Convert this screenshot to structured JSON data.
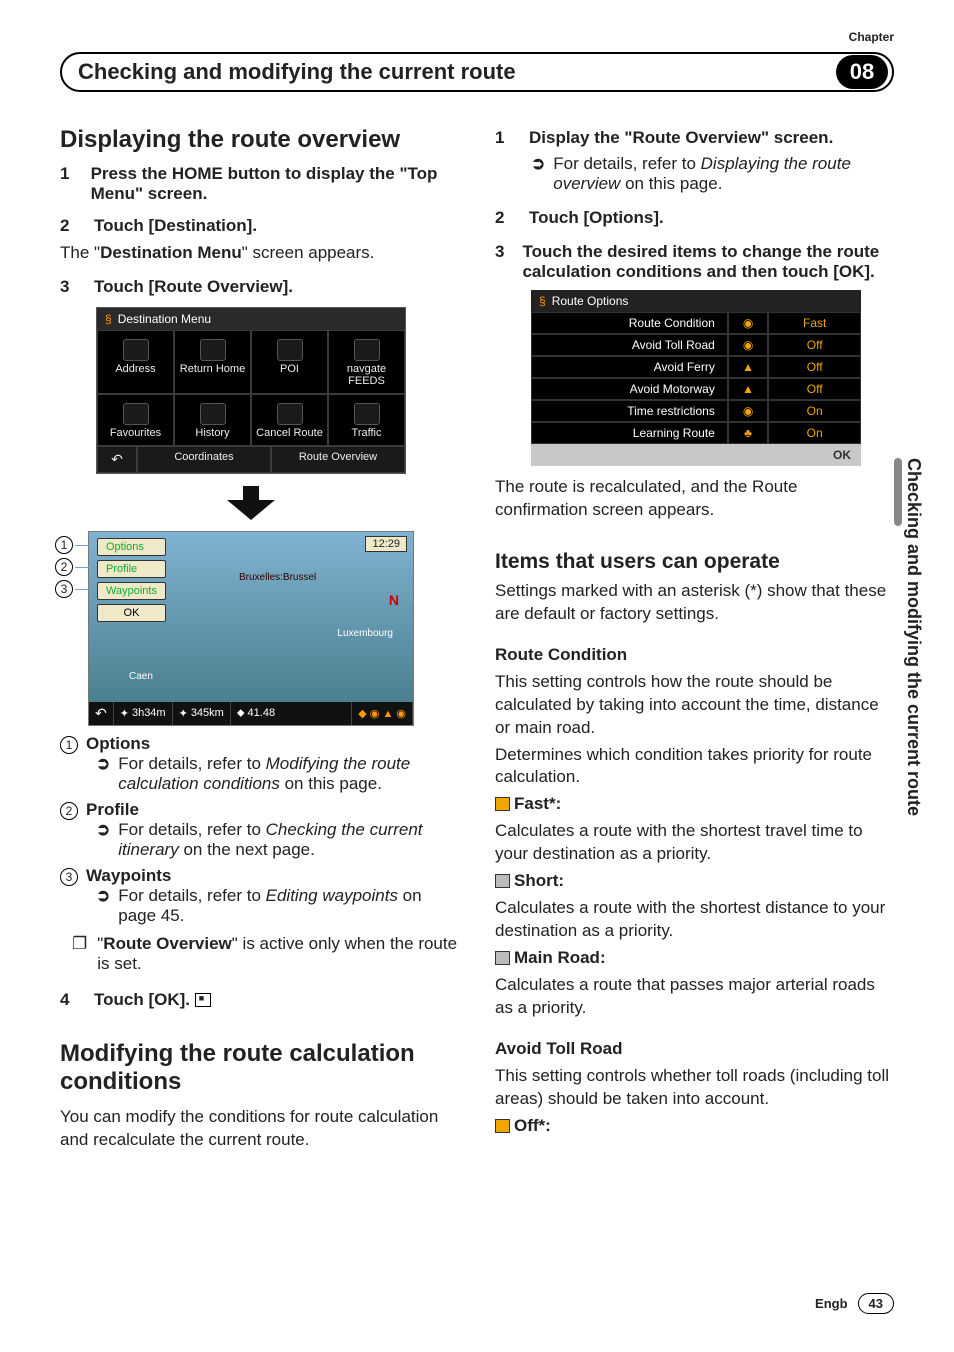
{
  "chapterLabel": "Chapter",
  "chapterNum": "08",
  "topTitle": "Checking and modifying the current route",
  "sideTitle": "Checking and modifying the current route",
  "left": {
    "h1": "Displaying the route overview",
    "s1": "Press the HOME button to display the \"Top Menu\" screen.",
    "s2": "Touch [Destination].",
    "s2b": "The \"Destination Menu\" screen appears.",
    "s3": "Touch [Route Overview].",
    "destHeader": "Destination Menu",
    "destItems": [
      "Address",
      "Return Home",
      "POI",
      "navgate FEEDS",
      "Favourites",
      "History",
      "Cancel Route",
      "Traffic"
    ],
    "destFoot": [
      "Coordinates",
      "Route Overview"
    ],
    "rov": {
      "menu": [
        "Options",
        "Profile",
        "Waypoints",
        "OK"
      ],
      "time": "12:29",
      "city": "Bruxelles:Brussel",
      "lux": "Luxembourg",
      "caen": "Caen",
      "foot": [
        "3h34m",
        "345km",
        "41.48"
      ]
    },
    "list": {
      "l1": "Options",
      "l1r": "For details, refer to Modifying the route calculation conditions on this page.",
      "l2": "Profile",
      "l2r": "For details, refer to Checking the current itinerary on the next page.",
      "l3": "Waypoints",
      "l3r": "For details, refer to Editing waypoints on page 45.",
      "note": "\"Route Overview\" is active only when the route is set."
    },
    "s4": "Touch [OK].",
    "h2": "Modifying the route calculation conditions",
    "h2p": "You can modify the conditions for route calculation and recalculate the current route."
  },
  "right": {
    "s1": "Display the \"Route Overview\" screen.",
    "s1r": "For details, refer to Displaying the route overview on this page.",
    "s2": "Touch [Options].",
    "s3": "Touch the desired items to change the route calculation conditions and then touch [OK].",
    "roptHeader": "Route Options",
    "ropt": [
      {
        "label": "Route Condition",
        "val": "Fast"
      },
      {
        "label": "Avoid Toll Road",
        "val": "Off"
      },
      {
        "label": "Avoid Ferry",
        "val": "Off"
      },
      {
        "label": "Avoid Motorway",
        "val": "Off"
      },
      {
        "label": "Time restrictions",
        "val": "On"
      },
      {
        "label": "Learning Route",
        "val": "On"
      }
    ],
    "roptOk": "OK",
    "recalc": "The route is recalculated, and the Route confirmation screen appears.",
    "h3": "Items that users can operate",
    "h3p": "Settings marked with an asterisk (*) show that these are default or factory settings.",
    "rc": {
      "title": "Route Condition",
      "p1": "This setting controls how the route should be calculated by taking into account the time, distance or main road.",
      "p2": "Determines which condition takes priority for route calculation.",
      "fast": "Fast*:",
      "fastp": "Calculates a route with the shortest travel time to your destination as a priority.",
      "short": "Short:",
      "shortp": "Calculates a route with the shortest distance to your destination as a priority.",
      "main": "Main Road:",
      "mainp": "Calculates a route that passes major arterial roads as a priority."
    },
    "atr": {
      "title": "Avoid Toll Road",
      "p": "This setting controls whether toll roads (including toll areas) should be taken into account.",
      "off": "Off*:"
    }
  },
  "footer": {
    "lang": "Engb",
    "page": "43"
  }
}
